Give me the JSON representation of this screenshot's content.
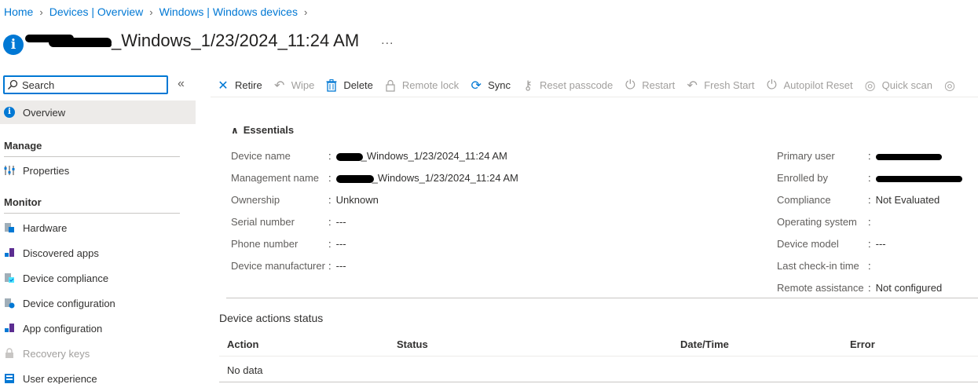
{
  "breadcrumb": [
    "Home",
    "Devices | Overview",
    "Windows | Windows devices"
  ],
  "page": {
    "title": "_Windows_1/23/2024_11:24 AM",
    "more": "..."
  },
  "sidebar": {
    "search_placeholder": "Search",
    "collapse": "«",
    "overview": "Overview",
    "manage_header": "Manage",
    "properties": "Properties",
    "monitor_header": "Monitor",
    "items": [
      "Hardware",
      "Discovered apps",
      "Device compliance",
      "Device configuration",
      "App configuration",
      "Recovery keys",
      "User experience"
    ]
  },
  "toolbar": {
    "retire": "Retire",
    "wipe": "Wipe",
    "delete": "Delete",
    "remote_lock": "Remote lock",
    "sync": "Sync",
    "reset_passcode": "Reset passcode",
    "restart": "Restart",
    "fresh_start": "Fresh Start",
    "autopilot_reset": "Autopilot Reset",
    "quick_scan": "Quick scan"
  },
  "essentials": {
    "header": "Essentials",
    "left": [
      {
        "label": "Device name",
        "value": "_Windows_1/23/2024_11:24 AM"
      },
      {
        "label": "Management name",
        "value": "_Windows_1/23/2024_11:24 AM"
      },
      {
        "label": "Ownership",
        "value": "Unknown"
      },
      {
        "label": "Serial number",
        "value": "---"
      },
      {
        "label": "Phone number",
        "value": "---"
      },
      {
        "label": "Device manufacturer",
        "value": "---"
      }
    ],
    "right": [
      {
        "label": "Primary user",
        "value": ""
      },
      {
        "label": "Enrolled by",
        "value": ""
      },
      {
        "label": "Compliance",
        "value": "Not Evaluated"
      },
      {
        "label": "Operating system",
        "value": ""
      },
      {
        "label": "Device model",
        "value": "---"
      },
      {
        "label": "Last check-in time",
        "value": ""
      },
      {
        "label": "Remote assistance",
        "value": "Not configured"
      }
    ]
  },
  "device_actions": {
    "title": "Device actions status",
    "columns": [
      "Action",
      "Status",
      "Date/Time",
      "Error"
    ],
    "empty": "No data"
  }
}
